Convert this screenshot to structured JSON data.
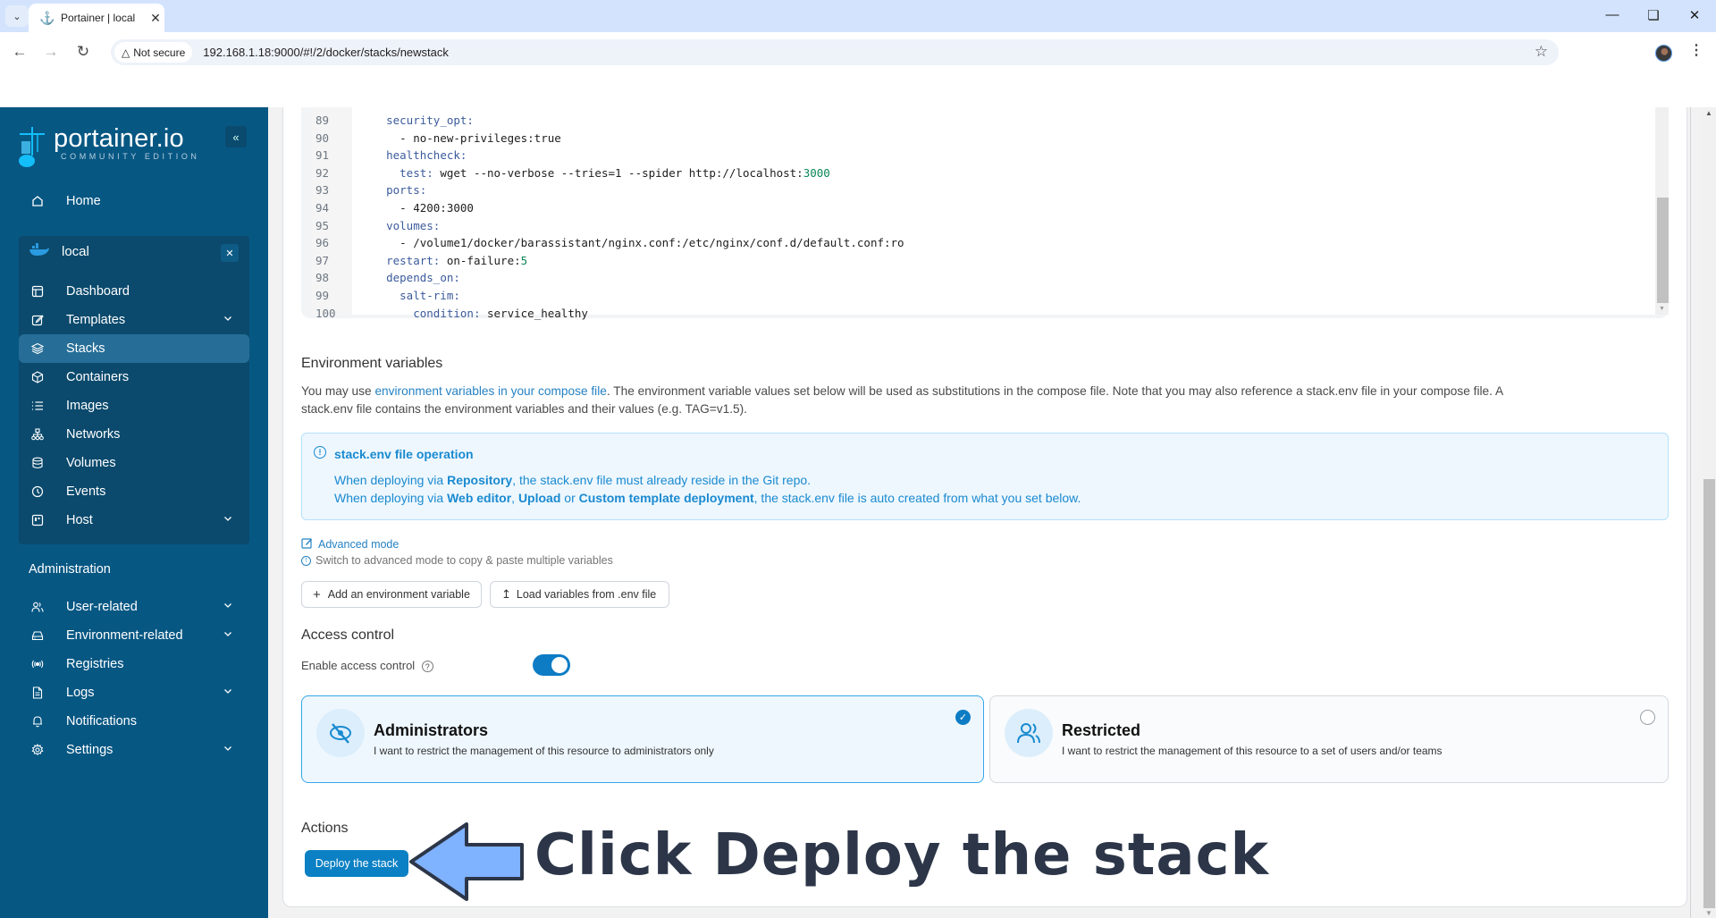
{
  "browser": {
    "tab_title": "Portainer | local",
    "security_label": "Not secure",
    "url": "192.168.1.18:9000/#!/2/docker/stacks/newstack"
  },
  "sidebar": {
    "logo_name": "portainer.io",
    "logo_edition": "COMMUNITY EDITION",
    "collapse_icon": "double-chevron-left-icon",
    "home": "Home",
    "environment": {
      "name": "local",
      "items": [
        {
          "label": "Dashboard",
          "icon": "layout-icon",
          "expandable": false,
          "active": false
        },
        {
          "label": "Templates",
          "icon": "edit-icon",
          "expandable": true,
          "active": false
        },
        {
          "label": "Stacks",
          "icon": "layers-icon",
          "expandable": false,
          "active": true
        },
        {
          "label": "Containers",
          "icon": "box-icon",
          "expandable": false,
          "active": false
        },
        {
          "label": "Images",
          "icon": "list-icon",
          "expandable": false,
          "active": false
        },
        {
          "label": "Networks",
          "icon": "network-icon",
          "expandable": false,
          "active": false
        },
        {
          "label": "Volumes",
          "icon": "database-icon",
          "expandable": false,
          "active": false
        },
        {
          "label": "Events",
          "icon": "clock-icon",
          "expandable": false,
          "active": false
        },
        {
          "label": "Host",
          "icon": "server-icon",
          "expandable": true,
          "active": false
        }
      ]
    },
    "admin_label": "Administration",
    "admin_items": [
      {
        "label": "User-related",
        "icon": "users-icon",
        "expandable": true
      },
      {
        "label": "Environment-related",
        "icon": "hard-drive-icon",
        "expandable": true
      },
      {
        "label": "Registries",
        "icon": "radio-icon",
        "expandable": false
      },
      {
        "label": "Logs",
        "icon": "file-text-icon",
        "expandable": true
      },
      {
        "label": "Notifications",
        "icon": "bell-icon",
        "expandable": false
      },
      {
        "label": "Settings",
        "icon": "gear-icon",
        "expandable": true
      }
    ]
  },
  "editor": {
    "lines": [
      {
        "n": "89",
        "indent": "    ",
        "key": "security_opt:",
        "val": "",
        "num": ""
      },
      {
        "n": "90",
        "indent": "      ",
        "key": "",
        "val": "- no-new-privileges:true",
        "num": ""
      },
      {
        "n": "91",
        "indent": "    ",
        "key": "healthcheck:",
        "val": "",
        "num": ""
      },
      {
        "n": "92",
        "indent": "      ",
        "key": "test:",
        "val": " wget --no-verbose --tries=1 --spider http://localhost:",
        "num": "3000"
      },
      {
        "n": "93",
        "indent": "    ",
        "key": "ports:",
        "val": "",
        "num": ""
      },
      {
        "n": "94",
        "indent": "      ",
        "key": "",
        "val": "- 4200:3000",
        "num": ""
      },
      {
        "n": "95",
        "indent": "    ",
        "key": "volumes:",
        "val": "",
        "num": ""
      },
      {
        "n": "96",
        "indent": "      ",
        "key": "",
        "val": "- /volume1/docker/barassistant/nginx.conf:/etc/nginx/conf.d/default.conf:ro",
        "num": ""
      },
      {
        "n": "97",
        "indent": "    ",
        "key": "restart:",
        "val": " on-failure:",
        "num": "5"
      },
      {
        "n": "98",
        "indent": "    ",
        "key": "depends_on:",
        "val": "",
        "num": ""
      },
      {
        "n": "99",
        "indent": "      ",
        "key": "salt-rim:",
        "val": "",
        "num": ""
      },
      {
        "n": "100",
        "indent": "        ",
        "key": "condition:",
        "val": " service_healthy",
        "num": ""
      }
    ]
  },
  "env_vars": {
    "heading": "Environment variables",
    "desc_prefix": "You may use ",
    "desc_link": "environment variables in your compose file",
    "desc_suffix": ". The environment variable values set below will be used as substitutions in the compose file. Note that you may also reference a stack.env file in your compose file. A",
    "desc_line2": "stack.env file contains the environment variables and their values (e.g. TAG=v1.5).",
    "info_title": "stack.env file operation",
    "info_line1": {
      "a": "When deploying via ",
      "b1": "Repository",
      "c": ", the stack.env file must already reside in the Git repo."
    },
    "info_line2": {
      "a": "When deploying via ",
      "b1": "Web editor",
      "sep1": ", ",
      "b2": "Upload",
      "sep2": " or ",
      "b3": "Custom template deployment",
      "c": ", the stack.env file is auto created from what you set below."
    },
    "advanced_mode": "Advanced mode",
    "advanced_hint": "Switch to advanced mode to copy & paste multiple variables",
    "add_button": "Add an environment variable",
    "load_button": "Load variables from .env file"
  },
  "access_control": {
    "heading": "Access control",
    "enable_label": "Enable access control",
    "enabled": true,
    "options": [
      {
        "title": "Administrators",
        "desc": "I want to restrict the management of this resource to administrators only",
        "selected": true
      },
      {
        "title": "Restricted",
        "desc": "I want to restrict the management of this resource to a set of users and/or teams",
        "selected": false
      }
    ]
  },
  "actions": {
    "heading": "Actions",
    "deploy_button": "Deploy the stack"
  },
  "annotation": {
    "text": "Click Deploy the stack"
  }
}
